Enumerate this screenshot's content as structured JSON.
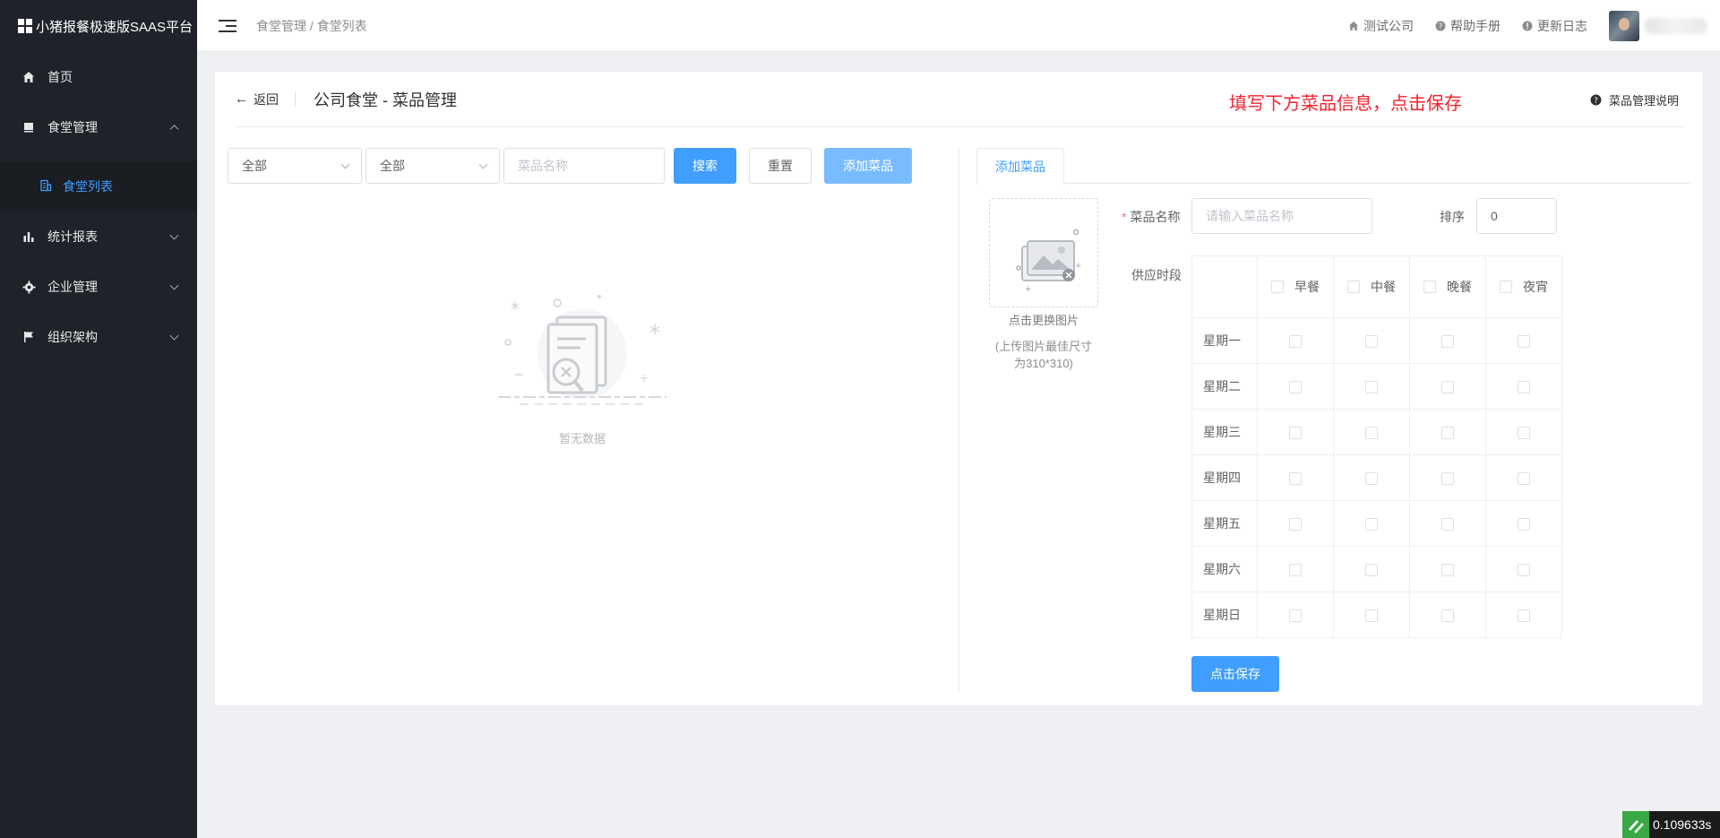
{
  "sidebar": {
    "logo_text": "小猪报餐极速版SAAS平台",
    "items": [
      {
        "label": "首页"
      },
      {
        "label": "食堂管理"
      },
      {
        "label": "食堂列表"
      },
      {
        "label": "统计报表"
      },
      {
        "label": "企业管理"
      },
      {
        "label": "组织架构"
      }
    ]
  },
  "header": {
    "breadcrumb": "食堂管理 / 食堂列表",
    "company": "测试公司",
    "help": "帮助手册",
    "changelog": "更新日志"
  },
  "card": {
    "back_label": "返回",
    "title": "公司食堂 - 菜品管理",
    "tip": "填写下方菜品信息，点击保存",
    "help_link": "菜品管理说明"
  },
  "filters": {
    "select1": "全部",
    "select2": "全部",
    "name_placeholder": "菜品名称",
    "search_label": "搜索",
    "reset_label": "重置",
    "add_label": "添加菜品"
  },
  "empty": {
    "text": "暂无数据"
  },
  "form": {
    "tab_label": "添加菜品",
    "upload_caption": "点击更换图片",
    "upload_hint_1": "(上传图片最佳尺寸",
    "upload_hint_2": "为310*310)",
    "name_label": "菜品名称",
    "name_placeholder": "请输入菜品名称",
    "sort_label": "排序",
    "sort_value": "0",
    "period_label": "供应时段",
    "meals": [
      "早餐",
      "中餐",
      "晚餐",
      "夜宵"
    ],
    "days": [
      "星期一",
      "星期二",
      "星期三",
      "星期四",
      "星期五",
      "星期六",
      "星期日"
    ],
    "save_label": "点击保存"
  },
  "timer": {
    "value": "0.109633s"
  },
  "colors": {
    "primary": "#409eff",
    "sidebar_bg": "#1f2329",
    "tip_red": "#f5222d"
  }
}
